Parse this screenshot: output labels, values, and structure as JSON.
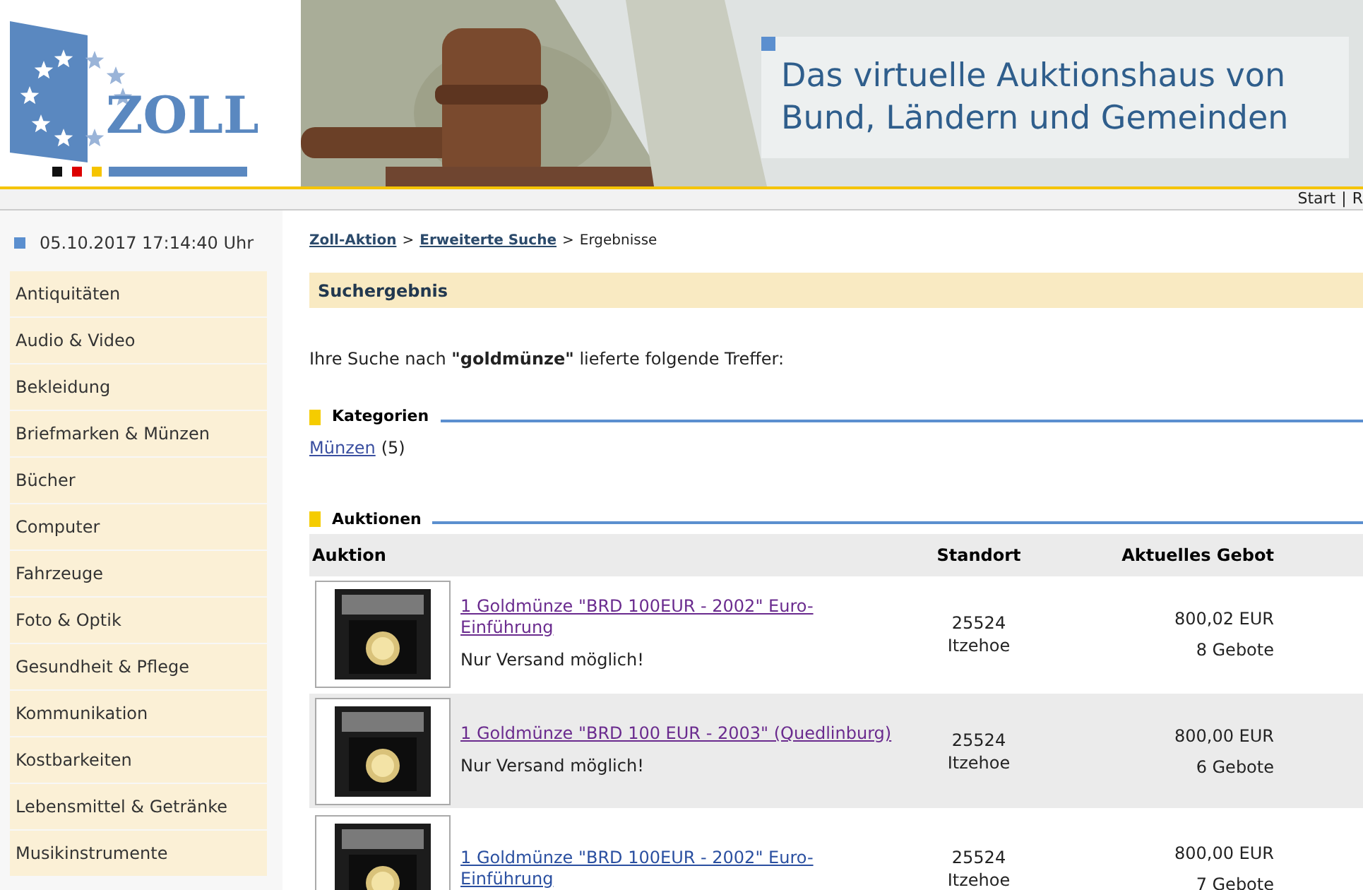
{
  "header": {
    "logo_text": "ZOLL",
    "tagline_lines": [
      "Das virtuelle Auktionshaus von",
      "Bund, Ländern und Gemeinden"
    ]
  },
  "top_bar": {
    "links": [
      "Start",
      "|",
      "R"
    ]
  },
  "sidebar": {
    "datetime": "05.10.2017 17:14:40 Uhr",
    "items": [
      "Antiquitäten",
      "Audio & Video",
      "Bekleidung",
      "Briefmarken & Münzen",
      "Bücher",
      "Computer",
      "Fahrzeuge",
      "Foto & Optik",
      "Gesundheit & Pflege",
      "Kommunikation",
      "Kostbarkeiten",
      "Lebensmittel & Getränke",
      "Musikinstrumente"
    ]
  },
  "breadcrumb": [
    {
      "label": "Zoll-Aktion",
      "kind": "link"
    },
    {
      "label": ">",
      "kind": "sep"
    },
    {
      "label": "Erweiterte Suche",
      "kind": "link"
    },
    {
      "label": ">",
      "kind": "sep"
    },
    {
      "label": "Ergebnisse",
      "kind": "text"
    }
  ],
  "title": "Suchergebnis",
  "summary": "Ihre Suche nach **\"goldmünze\"** lieferte folgende Treffer:",
  "categories": {
    "heading": "Kategorien",
    "items": [
      {
        "label": "Münzen",
        "count": "(5)"
      }
    ]
  },
  "auctions": {
    "heading": "Auktionen",
    "columns": [
      "Auktion",
      "Standort",
      "Aktuelles Gebot"
    ],
    "rows": [
      {
        "title": "1 Goldmünze \"BRD 100EUR - 2002\" Euro-Einführung",
        "visited": true,
        "note": "Nur Versand möglich!",
        "zip": "25524",
        "city": "Itzehoe",
        "price": "800,02 EUR",
        "bids": "8 Gebote"
      },
      {
        "title": "1 Goldmünze \"BRD 100 EUR - 2003\" (Quedlinburg)",
        "visited": true,
        "note": "Nur Versand möglich!",
        "zip": "25524",
        "city": "Itzehoe",
        "price": "800,00 EUR",
        "bids": "6 Gebote"
      },
      {
        "title": "1 Goldmünze \"BRD 100EUR - 2002\" Euro-Einführung",
        "visited": false,
        "zip": "25524",
        "city": "Itzehoe",
        "price": "800,00 EUR",
        "bids": "7 Gebote"
      }
    ]
  }
}
